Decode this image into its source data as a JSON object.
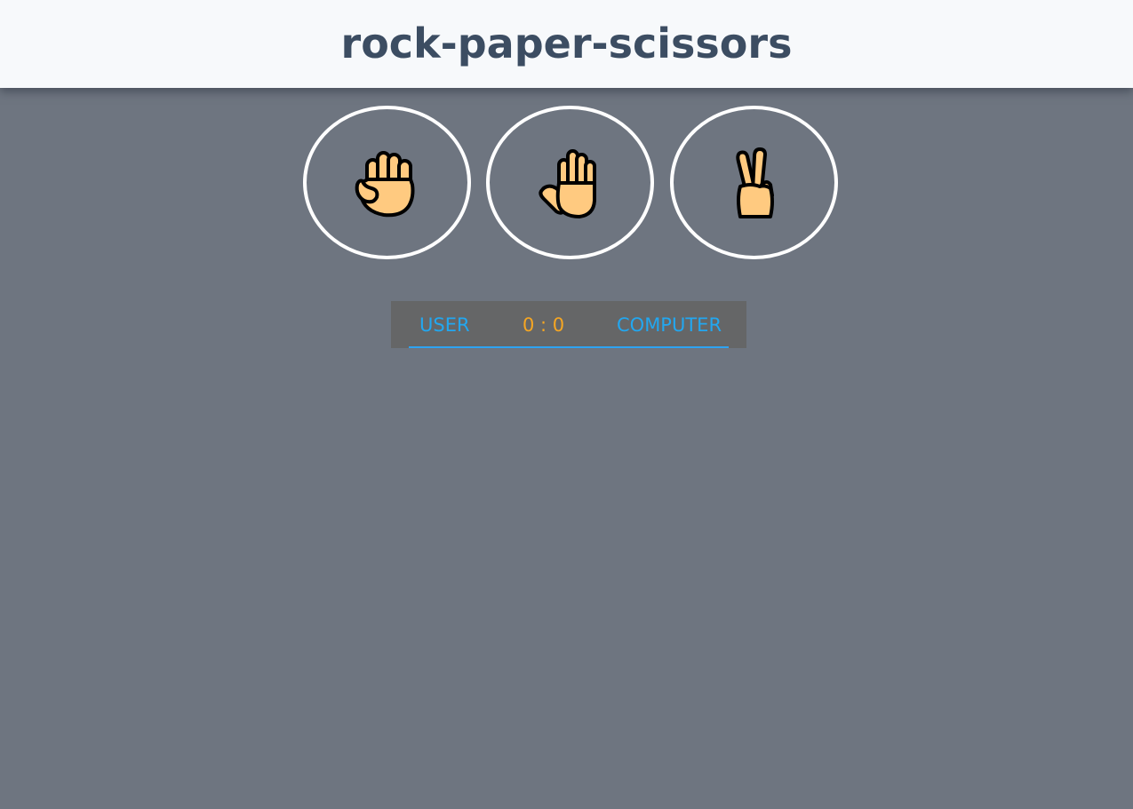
{
  "header": {
    "title": "rock-paper-scissors"
  },
  "choices": [
    {
      "name": "rock",
      "icon": "rock-fist-icon"
    },
    {
      "name": "paper",
      "icon": "paper-hand-icon"
    },
    {
      "name": "scissors",
      "icon": "scissors-victory-hand-icon"
    }
  ],
  "scoreboard": {
    "user_label": "USER",
    "score": "0 : 0",
    "computer_label": "COMPUTER"
  },
  "colors": {
    "background": "#6e7580",
    "header_bg": "#f7f9fb",
    "title": "#3c4d62",
    "accent_blue": "#22a7f0",
    "score_orange": "#f5a623",
    "hand_skin": "#ffca80",
    "scoreboard_bg": "#656667"
  }
}
